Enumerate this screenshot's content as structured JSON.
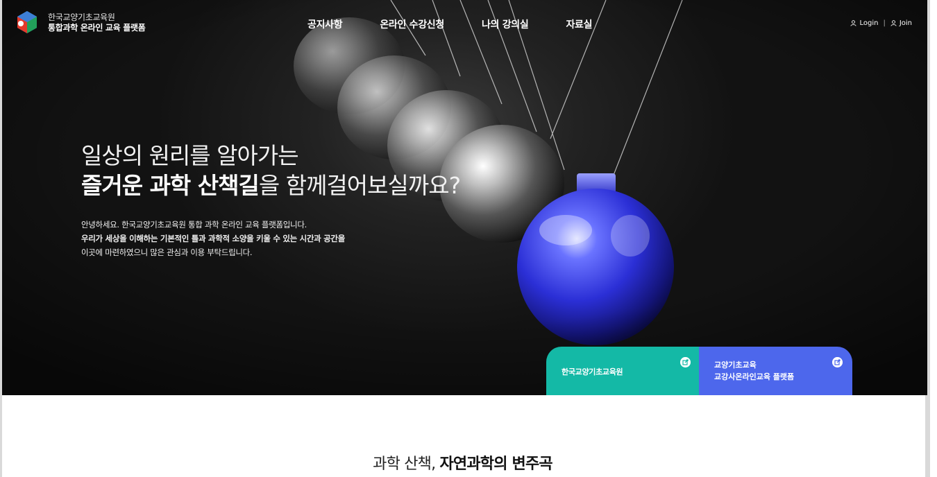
{
  "brand": {
    "line1": "한국교양기초교육원",
    "line2": "통합과학 온라인 교육 플랫폼"
  },
  "nav": {
    "items": [
      {
        "label": "공지사항"
      },
      {
        "label": "온라인 수강신청"
      },
      {
        "label": "나의 강의실"
      },
      {
        "label": "자료실"
      }
    ]
  },
  "auth": {
    "login": "Login",
    "separator": "|",
    "join": "Join"
  },
  "hero": {
    "line1": "일상의 원리를 알아가는",
    "line2_bold": "즐거운 과학 산책길",
    "line2_rest": "을 함께걸어보실까요?",
    "desc": [
      "안녕하세요. 한국교양기초교육원 통합 과학 온라인 교육 플랫폼입니다.",
      "우리가 세상을 이해하는 기본적인 틀과 과학적 소양을 키울 수 있는 시간과 공간을",
      "이곳에 마련하였으니 많은 관심과 이용 부탁드립니다."
    ]
  },
  "cards": [
    {
      "title": "한국교양기초교육원",
      "icon": "external-link-icon",
      "color": "#14b9a6"
    },
    {
      "title_1": "교양기초교육",
      "title_2": "교강사온라인교육 플랫폼",
      "icon": "external-link-icon",
      "color": "#4d67ec"
    }
  ],
  "section": {
    "title_light": "과학 산책, ",
    "title_bold": "자연과학의 변주곡"
  },
  "colors": {
    "teal": "#14b9a6",
    "blue": "#4d67ec",
    "hero_bg": "#111111"
  }
}
